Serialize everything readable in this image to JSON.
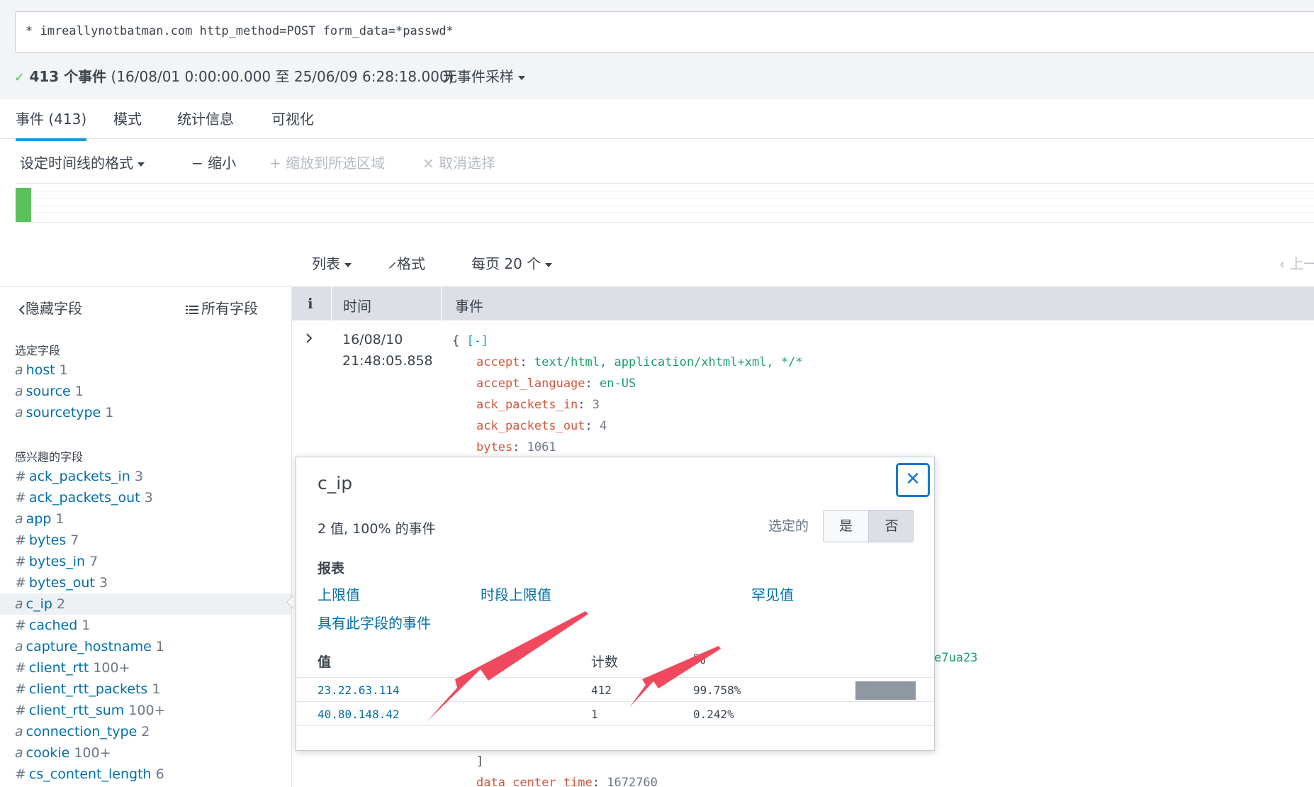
{
  "search": {
    "query": "* imreallynotbatman.com http_method=POST form_data=*passwd*"
  },
  "status": {
    "check": "✓",
    "count": "413 个事件",
    "range": "(16/08/01 0:00:00.000 至 25/06/09 6:28:18.000)",
    "sampling": "无事件采样"
  },
  "tabs": [
    {
      "label": "事件 (413)"
    },
    {
      "label": "模式"
    },
    {
      "label": "统计信息"
    },
    {
      "label": "可视化"
    }
  ],
  "timeline": {
    "format": "设定时间线的格式",
    "zoom_out": "− 缩小",
    "zoom_selection": "+ 缩放到所选区域",
    "deselect": "× 取消选择"
  },
  "results_toolbar": {
    "list": "列表",
    "format": "格式",
    "per_page": "每页 20 个",
    "prev": "‹ 上一"
  },
  "sidebar": {
    "hide_fields": "隐藏字段",
    "all_fields": "所有字段",
    "selected_title": "选定字段",
    "selected_fields": [
      {
        "type": "a",
        "name": "host",
        "count": "1"
      },
      {
        "type": "a",
        "name": "source",
        "count": "1"
      },
      {
        "type": "a",
        "name": "sourcetype",
        "count": "1"
      }
    ],
    "interesting_title": "感兴趣的字段",
    "interesting_fields": [
      {
        "type": "#",
        "name": "ack_packets_in",
        "count": "3"
      },
      {
        "type": "#",
        "name": "ack_packets_out",
        "count": "3"
      },
      {
        "type": "a",
        "name": "app",
        "count": "1"
      },
      {
        "type": "#",
        "name": "bytes",
        "count": "7"
      },
      {
        "type": "#",
        "name": "bytes_in",
        "count": "7"
      },
      {
        "type": "#",
        "name": "bytes_out",
        "count": "3"
      },
      {
        "type": "a",
        "name": "c_ip",
        "count": "2"
      },
      {
        "type": "#",
        "name": "cached",
        "count": "1"
      },
      {
        "type": "a",
        "name": "capture_hostname",
        "count": "1"
      },
      {
        "type": "#",
        "name": "client_rtt",
        "count": "100+"
      },
      {
        "type": "#",
        "name": "client_rtt_packets",
        "count": "1"
      },
      {
        "type": "#",
        "name": "client_rtt_sum",
        "count": "100+"
      },
      {
        "type": "a",
        "name": "connection_type",
        "count": "2"
      },
      {
        "type": "a",
        "name": "cookie",
        "count": "100+"
      },
      {
        "type": "#",
        "name": "cs_content_length",
        "count": "6"
      }
    ]
  },
  "events_table": {
    "col_info": "i",
    "col_time": "时间",
    "col_event": "事件",
    "event": {
      "date": "16/08/10",
      "time": "21:48:05.858",
      "open": "{ ",
      "collapse": "[-]",
      "lines": [
        {
          "key": "accept",
          "value": "text/html, application/xhtml+xml, */*",
          "kind": "str"
        },
        {
          "key": "accept_language",
          "value": "en-US",
          "kind": "str"
        },
        {
          "key": "ack_packets_in",
          "value": "3",
          "kind": "num"
        },
        {
          "key": "ack_packets_out",
          "value": "4",
          "kind": "num"
        },
        {
          "key": "bytes",
          "value": "1061",
          "kind": "num"
        }
      ],
      "partial_value": "e7ua23",
      "close_bracket": "]",
      "last_key": "data_center_time",
      "last_value": "1672760"
    }
  },
  "popover": {
    "title": "c_ip",
    "summary": "2 值, 100% 的事件",
    "selected_label": "选定的",
    "yes": "是",
    "no": "否",
    "reports_title": "报表",
    "reports": {
      "top_values": "上限值",
      "top_by_time": "时段上限值",
      "rare_values": "罕见值",
      "events_with_field": "具有此字段的事件"
    },
    "headers": {
      "value": "值",
      "count": "计数",
      "percent": "%"
    },
    "rows": [
      {
        "value": "23.22.63.114",
        "count": "412",
        "percent": "99.758%",
        "fraction": 0.99758
      },
      {
        "value": "40.80.148.42",
        "count": "1",
        "percent": "0.242%",
        "fraction": 0.00242
      }
    ]
  },
  "colors": {
    "accent": "#1a9cd1",
    "link": "#006eaa",
    "annotation_arrow": "#f0495d",
    "timeline_bar": "#5cc05c"
  }
}
